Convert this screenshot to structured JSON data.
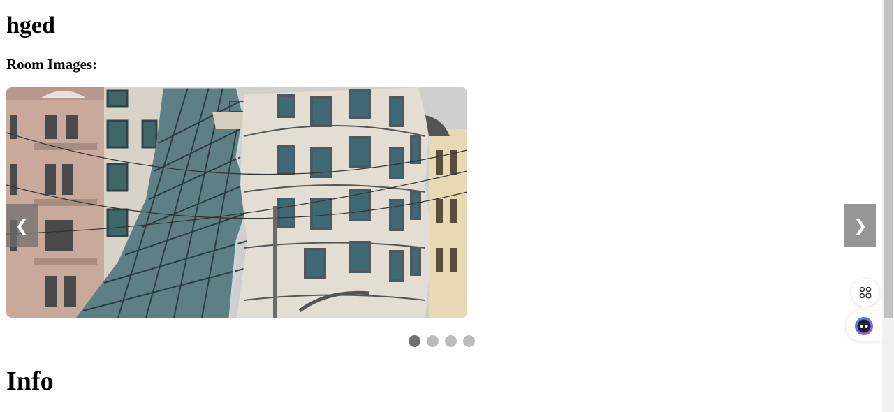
{
  "page": {
    "title": "hged",
    "subtitle": "Room Images:",
    "section_heading": "Info"
  },
  "carousel": {
    "image_description_icon": "building-photo",
    "prev_label": "❮",
    "next_label": "❯",
    "slide_count": 4,
    "active_index": 0
  },
  "floating": {
    "apps_icon": "apps-grid-icon",
    "assistant_icon": "assistant-face-icon"
  },
  "colors": {
    "dot_active": "#717171",
    "dot_inactive": "#bbbbbb",
    "nav_bg": "#6e6e6e"
  }
}
